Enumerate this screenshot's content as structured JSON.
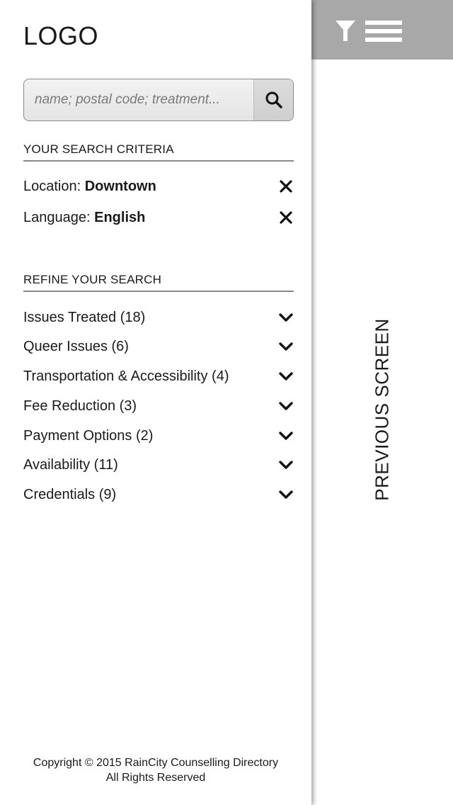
{
  "logo": "LOGO",
  "search": {
    "placeholder": "name; postal code; treatment..."
  },
  "criteria": {
    "title": "YOUR SEARCH CRITERIA",
    "items": [
      {
        "label": "Location: ",
        "value": "Downtown"
      },
      {
        "label": "Language: ",
        "value": "English"
      }
    ]
  },
  "refine": {
    "title": "REFINE YOUR SEARCH",
    "items": [
      {
        "label": "Issues Treated (18)"
      },
      {
        "label": "Queer Issues (6)"
      },
      {
        "label": "Transportation & Accessibility (4)"
      },
      {
        "label": "Fee Reduction (3)"
      },
      {
        "label": "Payment Options (2)"
      },
      {
        "label": "Availability (11)"
      },
      {
        "label": "Credentials (9)"
      }
    ]
  },
  "footer": {
    "line1": "Copyright © 2015 RainCity Counselling Directory",
    "line2": "All Rights Reserved"
  },
  "right_panel": {
    "label": "PREVIOUS SCREEN"
  },
  "icons": {
    "filter": "filter-icon",
    "menu": "hamburger-menu-icon",
    "search": "search-icon",
    "remove": "close-icon",
    "expand": "chevron-down-icon"
  },
  "colors": {
    "topbar": "#a8a8a8",
    "divider": "#8a8a8a"
  }
}
